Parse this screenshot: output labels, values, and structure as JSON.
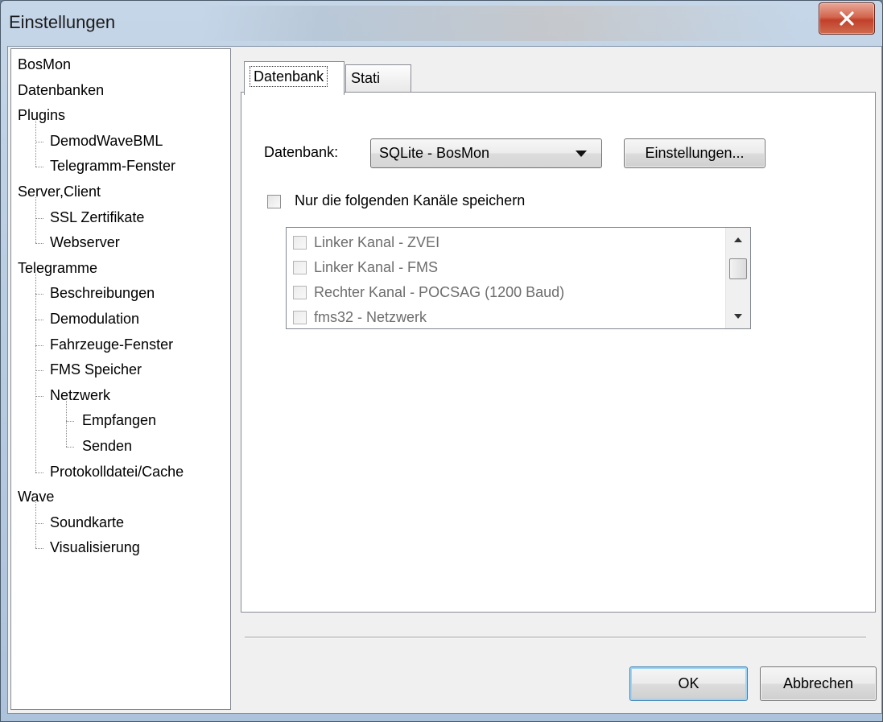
{
  "window": {
    "title": "Einstellungen"
  },
  "tree": {
    "items": [
      {
        "label": "BosMon",
        "level": 0
      },
      {
        "label": "Datenbanken",
        "level": 0
      },
      {
        "label": "Plugins",
        "level": 0
      },
      {
        "label": "DemodWaveBML",
        "level": 1
      },
      {
        "label": "Telegramm-Fenster",
        "level": 1
      },
      {
        "label": "Server,Client",
        "level": 0
      },
      {
        "label": "SSL Zertifikate",
        "level": 1
      },
      {
        "label": "Webserver",
        "level": 1
      },
      {
        "label": "Telegramme",
        "level": 0
      },
      {
        "label": "Beschreibungen",
        "level": 1
      },
      {
        "label": "Demodulation",
        "level": 1
      },
      {
        "label": "Fahrzeuge-Fenster",
        "level": 1
      },
      {
        "label": "FMS Speicher",
        "level": 1
      },
      {
        "label": "Netzwerk",
        "level": 1
      },
      {
        "label": "Empfangen",
        "level": 2
      },
      {
        "label": "Senden",
        "level": 2
      },
      {
        "label": "Protokolldatei/Cache",
        "level": 1
      },
      {
        "label": "Wave",
        "level": 0
      },
      {
        "label": "Soundkarte",
        "level": 1
      },
      {
        "label": "Visualisierung",
        "level": 1
      }
    ]
  },
  "tabs": [
    {
      "label": "Datenbank",
      "active": true
    },
    {
      "label": "Stati",
      "active": false
    }
  ],
  "database": {
    "label": "Datenbank:",
    "selected": "SQLite - BosMon",
    "settings_button": "Einstellungen..."
  },
  "channel_filter": {
    "checkbox_label": "Nur die folgenden Kanäle speichern",
    "checked": false,
    "channels": [
      {
        "label": "Linker Kanal - ZVEI",
        "checked": false
      },
      {
        "label": "Linker Kanal - FMS",
        "checked": false
      },
      {
        "label": "Rechter Kanal - POCSAG (1200 Baud)",
        "checked": false
      },
      {
        "label": "fms32 - Netzwerk",
        "checked": false
      }
    ]
  },
  "footer": {
    "ok_label": "OK",
    "cancel_label": "Abbrechen"
  },
  "colors": {
    "close_button": "#c1402a",
    "ok_border": "#3c7fb1"
  }
}
